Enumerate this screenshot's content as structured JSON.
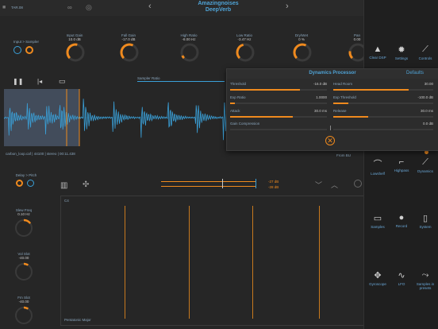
{
  "header": {
    "title": "Amazingnoises",
    "subtitle": "DeepVerb",
    "left_text": "TAR.08"
  },
  "toolbar": {
    "input_sampler": "Input > Sampler",
    "sampler_ratio": "Sampler Ratio"
  },
  "knobs": [
    {
      "label": "Input Gain",
      "value": "10.0 dB",
      "level": 0.55,
      "color": "#ef8a1e"
    },
    {
      "label": "Fall Gain",
      "value": "-17.0 dB",
      "level": 0.6,
      "color": "#ef8a1e"
    },
    {
      "label": "High Ratio",
      "value": "-8.00 Hz",
      "level": 0.08,
      "color": "#ef8a1e"
    },
    {
      "label": "Low Ratio",
      "value": "-3.47 Hz",
      "level": 0.45,
      "color": "#ef8a1e"
    },
    {
      "label": "Dry/Wet",
      "value": "0 %",
      "level": 0.6,
      "color": "#ef8a1e"
    },
    {
      "label": "Pan",
      "value": "0.00",
      "level": 0.2,
      "color": "#ef8a1e"
    }
  ],
  "file_info": "carbon_loop.caf | 44100 | stereo | 00:11.438",
  "delay_pitch": "Delay > Pitch",
  "left_knobs": [
    {
      "label": "Slew Freq",
      "value": "0.10 Hz",
      "level": 0.5
    },
    {
      "label": "Vol Slot",
      "value": "-40.00",
      "level": 0.3
    },
    {
      "label": "Fm Slot",
      "value": "-40.00",
      "level": 0.3
    }
  ],
  "meter": {
    "top": "-27 dB",
    "bottom": "-28 dB"
  },
  "piano_roll": {
    "note": "C4",
    "scale": "Pentatonic Major"
  },
  "dynamics": {
    "title": "Dynamics Processor",
    "defaults_label": "Defaults",
    "params_left": [
      {
        "label": "Threshold",
        "value": "-16.0 dB",
        "fill": 0.72
      },
      {
        "label": "Exp Ratio",
        "value": "1.0000",
        "fill": 0.05
      },
      {
        "label": "Attack",
        "value": "30.0 ms",
        "fill": 0.65
      },
      {
        "label": "Gain Compression",
        "value": "",
        "fill": 0.0
      }
    ],
    "params_right": [
      {
        "label": "Head Room",
        "value": "30.00",
        "fill": 0.75
      },
      {
        "label": "Exp Threshold",
        "value": "-100.0 dB",
        "fill": 0.15
      },
      {
        "label": "Release",
        "value": "30.0 ms",
        "fill": 0.35
      },
      {
        "label": "",
        "value": "0.0 dB",
        "fill": 0.0
      }
    ]
  },
  "right_panel": {
    "items_top": [
      {
        "label": "Clear DSP",
        "icon": "warning-icon"
      },
      {
        "label": "Settings",
        "icon": "gear-icon"
      },
      {
        "label": "Controls",
        "icon": "wrench-icon"
      }
    ],
    "filters": [
      {
        "label": "Lowshelf"
      },
      {
        "label": "Highpass"
      },
      {
        "label": "Dynamics"
      }
    ],
    "items_mid": [
      {
        "label": "Samples"
      },
      {
        "label": "Record"
      },
      {
        "label": "System"
      }
    ],
    "items_bottom": [
      {
        "label": "Gyroscope"
      },
      {
        "label": "LFO"
      },
      {
        "label": "Samples in presets"
      }
    ],
    "from_bu": "From BU"
  },
  "colors": {
    "accent": "#ef8a1e",
    "wave": "#3aa0d8"
  }
}
